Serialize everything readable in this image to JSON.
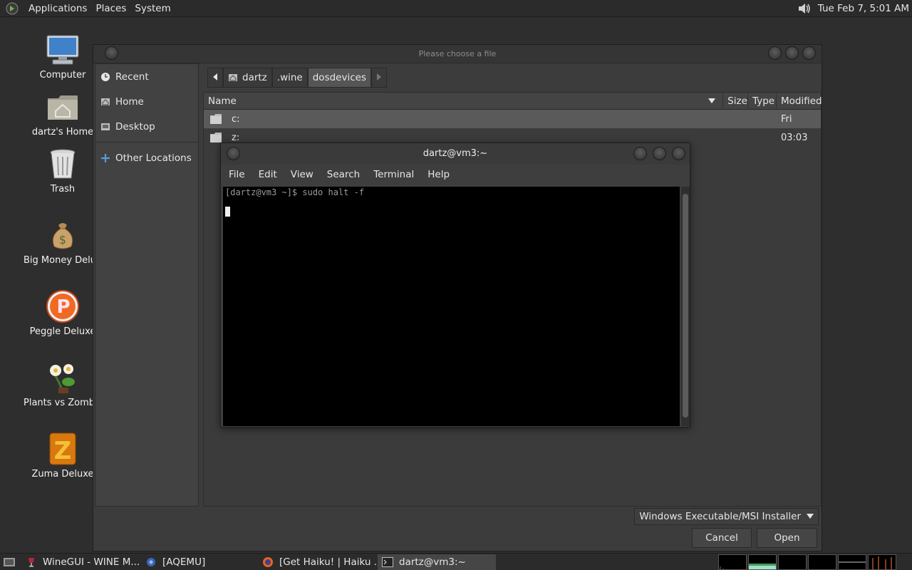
{
  "top_panel": {
    "menus": [
      "Applications",
      "Places",
      "System"
    ],
    "clock": "Tue Feb  7, 5:01 AM",
    "icons": {
      "logo": "gnome-foot-icon",
      "volume": "speaker-icon"
    }
  },
  "desktop": {
    "icons": [
      {
        "label": "Computer",
        "icon": "computer-icon"
      },
      {
        "label": "dartz's Home",
        "icon": "home-folder-icon"
      },
      {
        "label": "Trash",
        "icon": "trash-icon"
      },
      {
        "label": "Big Money Deluxe",
        "icon": "money-bag-icon"
      },
      {
        "label": "Peggle Deluxe",
        "icon": "peggle-icon"
      },
      {
        "label": "Plants vs Zombies",
        "icon": "plant-icon"
      },
      {
        "label": "Zuma Deluxe",
        "icon": "zuma-icon"
      }
    ]
  },
  "file_dialog": {
    "title": "Please choose a file",
    "places": [
      {
        "label": "Recent",
        "icon": "clock-icon"
      },
      {
        "label": "Home",
        "icon": "home-icon"
      },
      {
        "label": "Desktop",
        "icon": "desktop-icon"
      },
      {
        "label": "Other Locations",
        "icon": "plus-icon"
      }
    ],
    "path": [
      "dartz",
      ".wine",
      "dosdevices"
    ],
    "columns": {
      "name": "Name",
      "size": "Size",
      "type": "Type",
      "modified": "Modified"
    },
    "files": [
      {
        "name": "c:",
        "modified": "Fri",
        "selected": true
      },
      {
        "name": "z:",
        "modified": "03:03",
        "selected": false
      }
    ],
    "filter": "Windows Executable/MSI Installer",
    "cancel_label": "Cancel",
    "open_label": "Open"
  },
  "terminal": {
    "title": "dartz@vm3:~",
    "menus": [
      "File",
      "Edit",
      "View",
      "Search",
      "Terminal",
      "Help"
    ],
    "prompt_line": "[dartz@vm3 ~]$ sudo halt -f"
  },
  "taskbar": {
    "tasks": [
      {
        "label": "WineGUI - WINE M...",
        "icon": "wine-icon",
        "active": false
      },
      {
        "label": "[AQEMU]",
        "icon": "aqemu-icon",
        "active": false
      },
      {
        "label": "[Get Haiku! | Haiku ...",
        "icon": "firefox-icon",
        "active": false
      },
      {
        "label": "dartz@vm3:~",
        "icon": "terminal-icon",
        "active": true
      }
    ]
  }
}
